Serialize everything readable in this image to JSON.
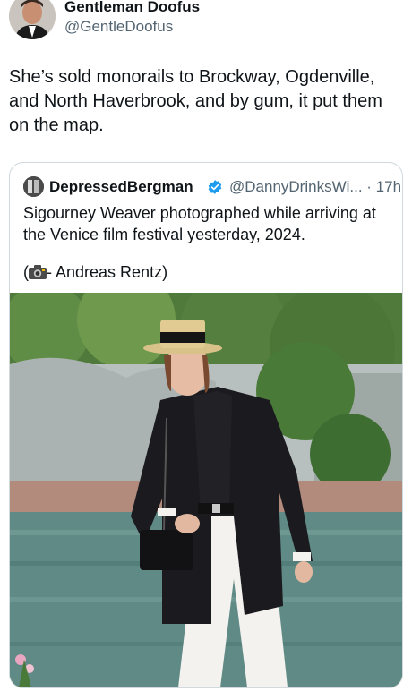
{
  "tweet": {
    "author_name": "Gentleman Doofus",
    "author_handle": "@GentleDoofus",
    "text": "She’s sold monorails to Brockway, Ogdenville, and North Haverbrook, and by gum, it put them on the map."
  },
  "quoted_tweet": {
    "author_name": "DepressedBergman",
    "verified": true,
    "handle_and_time": "@DannyDrinksWi... · 17h",
    "text": "Sigourney Weaver photographed while arriving at the Venice film festival yesterday, 2024.",
    "credit_prefix": "(",
    "credit_text": "- Andreas Rentz)",
    "photo_icon": "camera-icon"
  },
  "colors": {
    "text": "#0f1419",
    "secondary": "#536471",
    "border": "#cfd9de",
    "verified": "#1d9bf0"
  }
}
